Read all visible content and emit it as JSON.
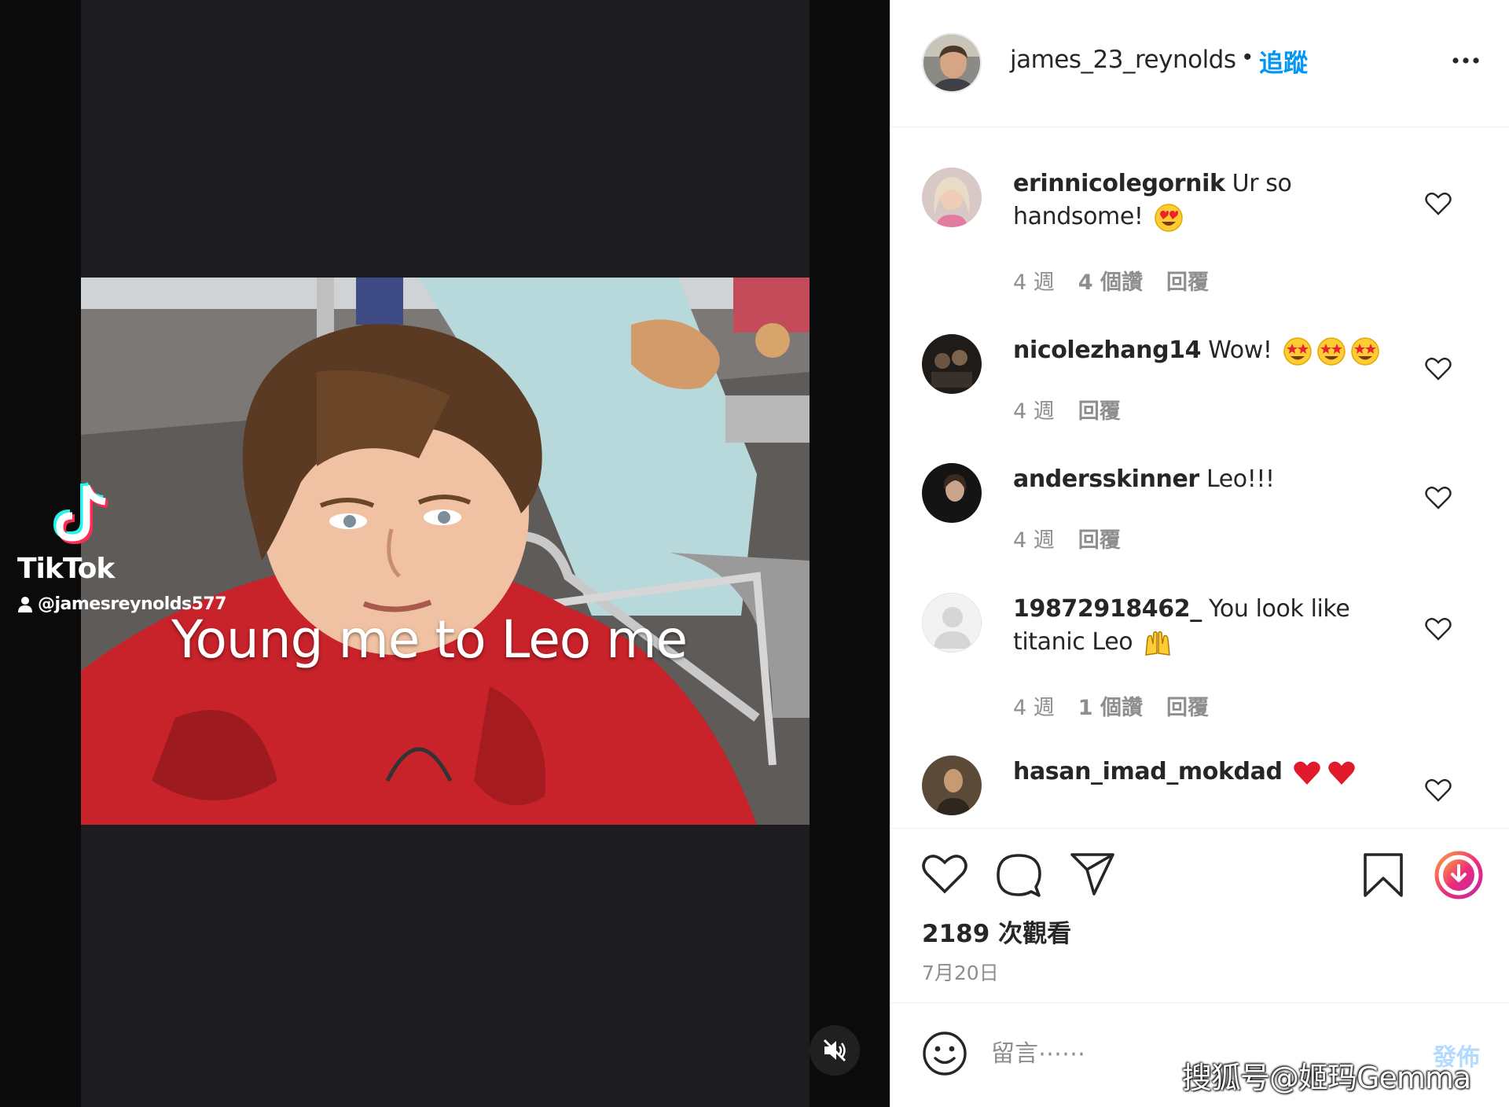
{
  "video": {
    "caption": "Young me to Leo me",
    "tiktok_brand": "TikTok",
    "tiktok_handle": "@jamesreynolds577",
    "mute_icon": "speaker-muted-icon"
  },
  "header": {
    "username": "james_23_reynolds",
    "separator": "•",
    "follow_label": "追蹤",
    "more_icon": "ellipsis-icon"
  },
  "comments": [
    {
      "username": "erinnicolegornik",
      "text": "Ur so handsome!",
      "emoji": "heart-eyes-emoji",
      "time": "4 週",
      "likes": "4 個讚",
      "reply": "回覆"
    },
    {
      "username": "nicolezhang14",
      "text": "Wow!",
      "emoji": "star-struck-emoji x3",
      "time": "4 週",
      "reply": "回覆"
    },
    {
      "username": "andersskinner",
      "text": "Leo!!!",
      "time": "4 週",
      "reply": "回覆"
    },
    {
      "username": "19872918462_",
      "text": "You look like titanic Leo",
      "emoji": "raising-hands-emoji",
      "time": "4 週",
      "likes": "1 個讚",
      "reply": "回覆"
    },
    {
      "username": "hasan_imad_mokdad",
      "text": "",
      "emoji": "red-heart-emoji x2"
    }
  ],
  "actions": {
    "like_icon": "heart-outline-icon",
    "comment_icon": "comment-bubble-icon",
    "share_icon": "paper-plane-icon",
    "save_icon": "bookmark-icon",
    "download_icon": "download-circle-icon",
    "views": "2189 次觀看",
    "date": "7月20日"
  },
  "composer": {
    "placeholder": "留言⋯⋯",
    "post_label": "發佈",
    "emoji_icon": "smiley-icon"
  },
  "watermark": "搜狐号@姬玛Gemma",
  "colors": {
    "accent": "#0095f6",
    "post_disabled": "#b3dbff",
    "muted_text": "#8e8e8e",
    "text": "#262626",
    "shirt_red": "#c8222a",
    "tiktok_cyan": "#25f4ee",
    "tiktok_pink": "#fe2c55"
  }
}
